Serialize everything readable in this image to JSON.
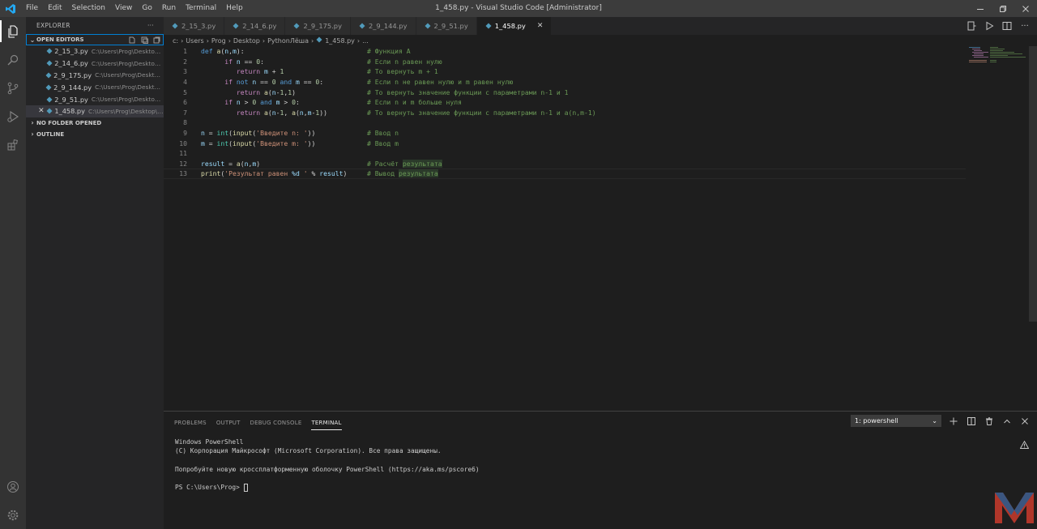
{
  "menu": [
    "File",
    "Edit",
    "Selection",
    "View",
    "Go",
    "Run",
    "Terminal",
    "Help"
  ],
  "window_title": "1_458.py - Visual Studio Code [Administrator]",
  "sidebar": {
    "title": "EXPLORER",
    "more": "···",
    "open_editors_label": "OPEN EDITORS",
    "open_editors": [
      {
        "name": "2_15_3.py",
        "path": "C:\\Users\\Prog\\Desktop\\..."
      },
      {
        "name": "2_14_6.py",
        "path": "C:\\Users\\Prog\\Desktop\\..."
      },
      {
        "name": "2_9_175.py",
        "path": "C:\\Users\\Prog\\Desktop\\..."
      },
      {
        "name": "2_9_144.py",
        "path": "C:\\Users\\Prog\\Desktop\\..."
      },
      {
        "name": "2_9_51.py",
        "path": "C:\\Users\\Prog\\Desktop\\..."
      },
      {
        "name": "1_458.py",
        "path": "C:\\Users\\Prog\\Desktop\\P...",
        "active": true
      }
    ],
    "no_folder_label": "NO FOLDER OPENED",
    "outline_label": "OUTLINE"
  },
  "tabs": [
    {
      "label": "2_15_3.py"
    },
    {
      "label": "2_14_6.py"
    },
    {
      "label": "2_9_175.py"
    },
    {
      "label": "2_9_144.py"
    },
    {
      "label": "2_9_51.py"
    },
    {
      "label": "1_458.py",
      "active": true
    }
  ],
  "breadcrumb": [
    "c:",
    "Users",
    "Prog",
    "Desktop",
    "PythonЛёша",
    "1_458.py",
    "..."
  ],
  "editor": {
    "line_numbers": [
      "1",
      "2",
      "3",
      "4",
      "5",
      "6",
      "7",
      "8",
      "9",
      "10",
      "11",
      "12",
      "13"
    ],
    "comments": {
      "l1": "# Функция A",
      "l2": "# Если n равен нулю",
      "l3": "# То вернуть m + 1",
      "l4": "# Если n не равен нулю и m равен нулю",
      "l5": "# То вернуть значение функции с параметрами n-1 и 1",
      "l6": "# Если n и m больше нуля",
      "l7": "# То вернуть значение функции с параметрами n-1 и a(n,m-1)",
      "l9": "# Ввод n",
      "l10": "# Ввод m",
      "l12_a": "# Расчёт ",
      "l12_b": "результата",
      "l13_a": "# Вывод ",
      "l13_b": "результата"
    },
    "strings": {
      "prompt_n": "'Введите n: '",
      "prompt_m": "'Введите m: '",
      "result_fmt_a": "'Результат равен ",
      "result_fmt_b": "%d",
      "result_fmt_c": " '"
    }
  },
  "panel": {
    "tabs": [
      "PROBLEMS",
      "OUTPUT",
      "DEBUG CONSOLE",
      "TERMINAL"
    ],
    "terminal_select": "1: powershell",
    "terminal_lines": [
      "Windows PowerShell",
      "(C) Корпорация Майкрософт (Microsoft Corporation). Все права защищены.",
      "",
      "Попробуйте новую кроссплатформенную оболочку PowerShell (https://aka.ms/pscore6)",
      "",
      "PS C:\\Users\\Prog> "
    ]
  },
  "colors": {
    "keyword": "#569cd6",
    "control": "#c586c0",
    "function": "#dcdcaa",
    "string": "#ce9178",
    "comment": "#6a9955",
    "number": "#b5cea8",
    "variable": "#9cdcfe"
  }
}
